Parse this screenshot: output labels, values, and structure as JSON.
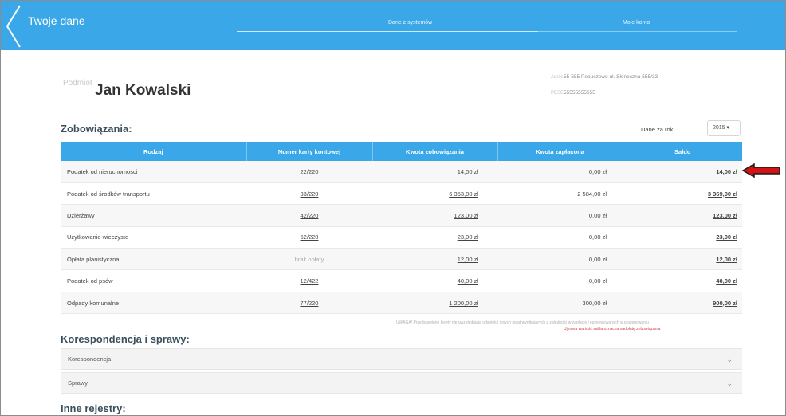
{
  "header": {
    "title": "Twoje dane",
    "tabs": [
      {
        "label": "Dane z systemów"
      },
      {
        "label": "Moje konto"
      }
    ]
  },
  "owner": {
    "label": "Podmiot",
    "name": "Jan Kowalski",
    "address_label": "Adres",
    "address": "55-555 Pobuczewo ul. Słoneczna 555/33",
    "id_label": "PESEL",
    "id_value": "55555555555"
  },
  "liabilities": {
    "title": "Zobowiązania:",
    "year_label": "Dane za rok:",
    "year_value": "2015",
    "columns": [
      "Rodzaj",
      "Numer karty kontowej",
      "Kwota zobowiązania",
      "Kwota zapłacona",
      "Saldo"
    ],
    "rows": [
      {
        "type": "Podatek od nieruchomości",
        "card": "22/220",
        "amount": "14,00 zł",
        "paid": "0,00 zł",
        "balance": "14,00 zł"
      },
      {
        "type": "Podatek od środków transportu",
        "card": "33/220",
        "amount": "6 353,00 zł",
        "paid": "2 584,00 zł",
        "balance": "3 369,00 zł"
      },
      {
        "type": "Dzierżawy",
        "card": "42/220",
        "amount": "123,00 zł",
        "paid": "0,00 zł",
        "balance": "123,00 zł"
      },
      {
        "type": "Użytkowanie wieczyste",
        "card": "52/220",
        "amount": "23,00 zł",
        "paid": "0,00 zł",
        "balance": "23,00 zł"
      },
      {
        "type": "Opłata planistyczna",
        "card": "brak opłaty",
        "amount": "12,00 zł",
        "paid": "0,00 zł",
        "balance": "12,00 zł"
      },
      {
        "type": "Podatek od psów",
        "card": "12/422",
        "amount": "40,00 zł",
        "paid": "0,00 zł",
        "balance": "40,00 zł"
      },
      {
        "type": "Odpady komunalne",
        "card": "77/220",
        "amount": "1 200,00 zł",
        "paid": "300,00 zł",
        "balance": "900,00 zł"
      }
    ],
    "note": "UWAGA! Przedstawione kwoty nie uwzględniają odsetek i innych opłat wynikających z zaległości w zapłacie i egzekwowanych w postępowaniu",
    "note_red": "Ujemna wartość salda oznacza nadpłatę zobowiązania"
  },
  "correspondence": {
    "title": "Korespondencja i sprawy:",
    "items": [
      {
        "label": "Korespondencja"
      },
      {
        "label": "Sprawy"
      }
    ]
  },
  "registers": {
    "title": "Inne rejestry:"
  },
  "colors": {
    "accent": "#3aa8e8",
    "arrow": "#d21414"
  }
}
